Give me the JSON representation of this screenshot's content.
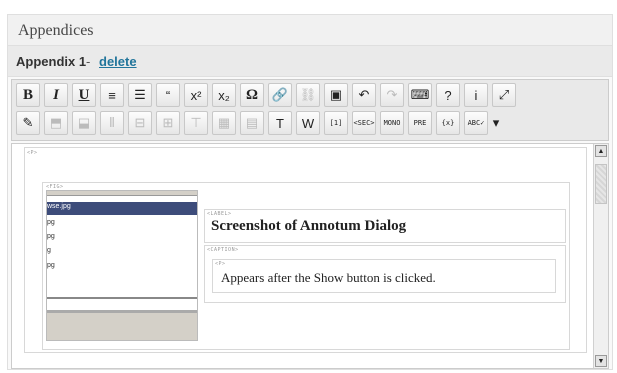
{
  "panel": {
    "title": "Appendices"
  },
  "appendix": {
    "label": "Appendix 1",
    "separator": "-",
    "delete_label": "delete"
  },
  "toolbar": {
    "row1": [
      {
        "name": "bold-button",
        "glyph": "B"
      },
      {
        "name": "italic-button",
        "glyph": "I"
      },
      {
        "name": "underline-button",
        "glyph": "U"
      },
      {
        "name": "ordered-list-button",
        "glyph": "≡"
      },
      {
        "name": "unordered-list-button",
        "glyph": "☰"
      },
      {
        "name": "blockquote-button",
        "glyph": "“"
      },
      {
        "name": "superscript-button",
        "glyph": "x²"
      },
      {
        "name": "subscript-button",
        "glyph": "x₂"
      },
      {
        "name": "special-character-button",
        "glyph": "Ω"
      },
      {
        "name": "link-button",
        "glyph": "🔗"
      },
      {
        "name": "unlink-button",
        "glyph": "⛓"
      },
      {
        "name": "insert-image-button",
        "glyph": "▣"
      },
      {
        "name": "undo-button",
        "glyph": "↶"
      },
      {
        "name": "redo-button",
        "glyph": "↷"
      },
      {
        "name": "keyboard-button",
        "glyph": "⌨"
      },
      {
        "name": "help-button",
        "glyph": "?"
      },
      {
        "name": "info-button",
        "glyph": "i"
      },
      {
        "name": "fullscreen-button",
        "glyph": "⤢"
      }
    ],
    "row2": [
      {
        "name": "edit-source-button",
        "glyph": "✎"
      },
      {
        "name": "insert-row-above-button",
        "glyph": "⬒"
      },
      {
        "name": "insert-row-below-button",
        "glyph": "⬓"
      },
      {
        "name": "insert-column-button",
        "glyph": "⫴"
      },
      {
        "name": "delete-row-button",
        "glyph": "⊟"
      },
      {
        "name": "delete-column-button",
        "glyph": "⊞"
      },
      {
        "name": "merge-cells-button",
        "glyph": "⊤"
      },
      {
        "name": "table-button",
        "glyph": "▦"
      },
      {
        "name": "table-props-button",
        "glyph": "▤"
      },
      {
        "name": "paste-text-button",
        "glyph": "T"
      },
      {
        "name": "paste-word-button",
        "glyph": "W"
      },
      {
        "name": "citation-button",
        "glyph": "[1]"
      },
      {
        "name": "section-button",
        "glyph": "<SEC>"
      },
      {
        "name": "mono-button",
        "glyph": "MONO"
      },
      {
        "name": "preformatted-button",
        "glyph": "PRE"
      },
      {
        "name": "variable-button",
        "glyph": "{x}"
      },
      {
        "name": "spellcheck-button",
        "glyph": "ABC✓"
      },
      {
        "name": "spellcheck-dropdown-button",
        "glyph": "▾"
      }
    ]
  },
  "editor": {
    "p_tag": "<P>",
    "fig_tag": "<FIG>",
    "label_tag": "<LABEL>",
    "caption_tag": "<CAPTION>",
    "caption_p_tag": "<P>",
    "label_text": "Screenshot of Annotum Dialog",
    "caption_text": "Appears after the Show button is clicked.",
    "thumbnail": {
      "selected_item": "wse.jpg",
      "items": [
        "pg",
        "pg",
        "g",
        "pg"
      ]
    }
  },
  "colors": {
    "link": "#21759b",
    "selection": "#3d4c7a"
  }
}
